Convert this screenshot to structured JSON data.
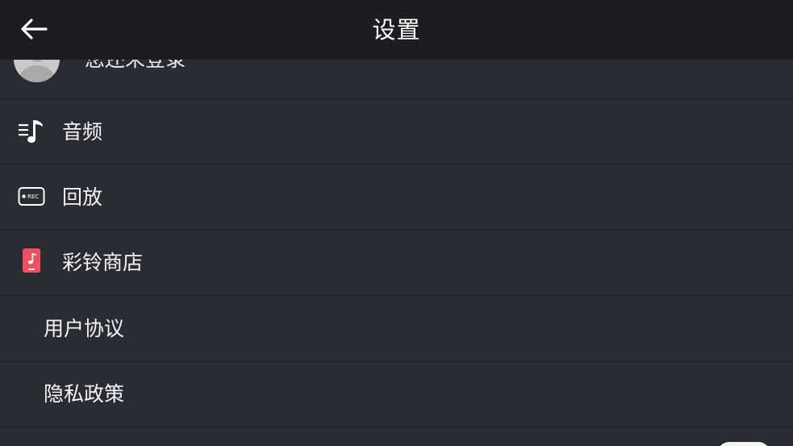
{
  "header": {
    "title": "设置"
  },
  "profile": {
    "name": "您还未登录"
  },
  "items": [
    {
      "label": "音频",
      "icon": "music-list-icon"
    },
    {
      "label": "回放",
      "icon": "rec-icon",
      "icon_text": "REC"
    },
    {
      "label": "彩铃商店",
      "icon": "ringtone-store-icon",
      "icon_color": "#f0505f"
    },
    {
      "label": "用户协议"
    },
    {
      "label": "隐私政策"
    }
  ],
  "colors": {
    "background": "#2a2c33",
    "topbar": "#1c1d20",
    "divider": "#232429",
    "accent_red": "#f0505f"
  }
}
